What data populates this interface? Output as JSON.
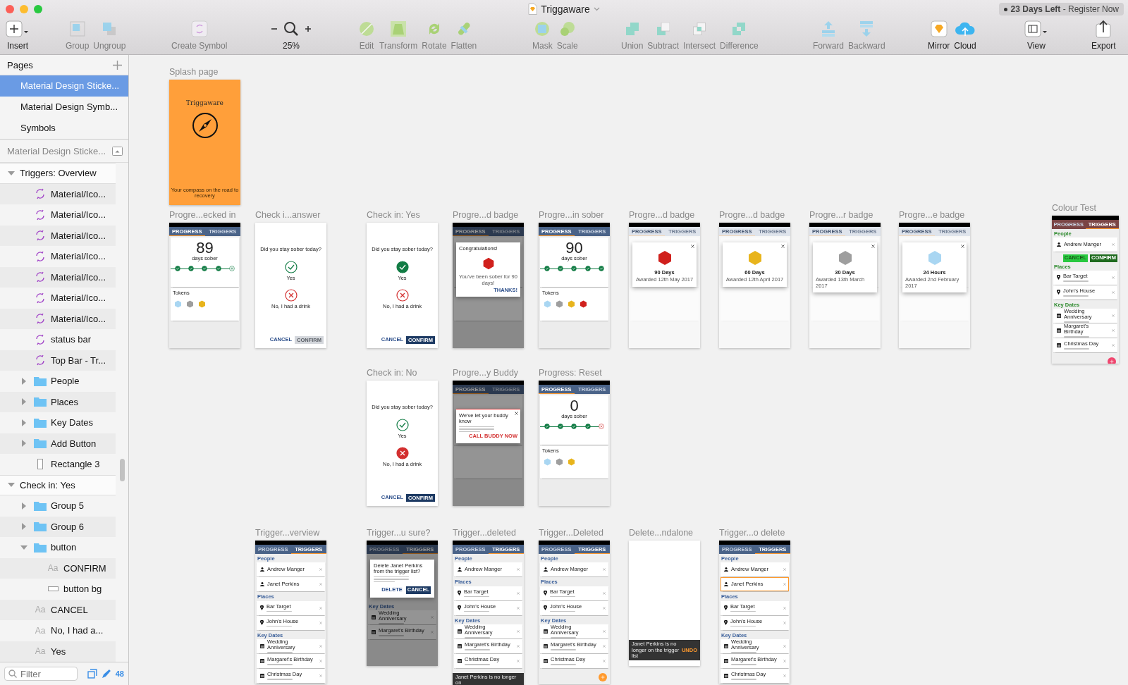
{
  "window": {
    "title": "Triggaware",
    "trial": "**23 Days Left** - Register Now"
  },
  "toolbar": {
    "groups": [
      {
        "tools": [
          {
            "label": "Insert",
            "kind": "insert",
            "disabled": false
          }
        ]
      },
      {
        "tools": [
          {
            "label": "Group",
            "kind": "group",
            "disabled": true
          },
          {
            "label": "Ungroup",
            "kind": "ungroup",
            "disabled": true
          }
        ]
      },
      {
        "tools": [
          {
            "label": "Create Symbol",
            "kind": "symbol",
            "disabled": true
          }
        ]
      },
      {
        "tools": [
          {
            "label": "25%",
            "kind": "zoom",
            "disabled": false
          }
        ]
      },
      {
        "tools": [
          {
            "label": "Edit",
            "kind": "edit",
            "disabled": true
          },
          {
            "label": "Transform",
            "kind": "transform",
            "disabled": true
          },
          {
            "label": "Rotate",
            "kind": "rotate",
            "disabled": true
          },
          {
            "label": "Flatten",
            "kind": "flatten",
            "disabled": true
          }
        ]
      },
      {
        "tools": [
          {
            "label": "Mask",
            "kind": "mask",
            "disabled": true
          },
          {
            "label": "Scale",
            "kind": "scale",
            "disabled": true
          }
        ]
      },
      {
        "tools": [
          {
            "label": "Union",
            "kind": "union",
            "disabled": true
          },
          {
            "label": "Subtract",
            "kind": "subtract",
            "disabled": true
          },
          {
            "label": "Intersect",
            "kind": "intersect",
            "disabled": true
          },
          {
            "label": "Difference",
            "kind": "difference",
            "disabled": true
          }
        ]
      },
      {
        "tools": [
          {
            "label": "Forward",
            "kind": "forward",
            "disabled": true
          },
          {
            "label": "Backward",
            "kind": "backward",
            "disabled": true
          }
        ]
      },
      {
        "tools": [
          {
            "label": "Mirror",
            "kind": "mirror",
            "disabled": false
          },
          {
            "label": "Cloud",
            "kind": "cloud",
            "disabled": false
          }
        ]
      },
      {
        "tools": [
          {
            "label": "View",
            "kind": "view",
            "disabled": false
          }
        ]
      },
      {
        "tools": [
          {
            "label": "Export",
            "kind": "export",
            "disabled": false
          }
        ]
      }
    ]
  },
  "sidebar": {
    "pages_title": "Pages",
    "pages": [
      {
        "label": "Material Design Sticke...",
        "selected": true
      },
      {
        "label": "Material Design Symb...",
        "selected": false
      },
      {
        "label": "Symbols",
        "selected": false
      }
    ],
    "page_header": "Material Design Sticke...",
    "layers": [
      {
        "label": "Triggers: Overview",
        "kind": "artboard",
        "expanded": true,
        "children": [
          {
            "label": "Material/Ico...",
            "kind": "symbol"
          },
          {
            "label": "Material/Ico...",
            "kind": "symbol"
          },
          {
            "label": "Material/Ico...",
            "kind": "symbol"
          },
          {
            "label": "Material/Ico...",
            "kind": "symbol"
          },
          {
            "label": "Material/Ico...",
            "kind": "symbol"
          },
          {
            "label": "Material/Ico...",
            "kind": "symbol"
          },
          {
            "label": "Material/Ico...",
            "kind": "symbol"
          },
          {
            "label": "status bar",
            "kind": "symbol"
          },
          {
            "label": "Top Bar - Tr...",
            "kind": "symbol"
          },
          {
            "label": "People",
            "kind": "folder",
            "expanded": false
          },
          {
            "label": "Places",
            "kind": "folder",
            "expanded": false
          },
          {
            "label": "Key Dates",
            "kind": "folder",
            "expanded": false
          },
          {
            "label": "Add Button",
            "kind": "folder",
            "expanded": false
          },
          {
            "label": "Rectangle 3",
            "kind": "rect"
          }
        ]
      },
      {
        "label": "Check in: Yes",
        "kind": "artboard",
        "expanded": true,
        "children": [
          {
            "label": "Group 5",
            "kind": "folder",
            "expanded": false
          },
          {
            "label": "Group 6",
            "kind": "folder",
            "expanded": false
          },
          {
            "label": "button",
            "kind": "folder",
            "expanded": true,
            "children": [
              {
                "label": "CONFIRM",
                "kind": "text",
                "glyph": "Aa"
              },
              {
                "label": "button bg",
                "kind": "bar"
              }
            ]
          },
          {
            "label": "CANCEL",
            "kind": "text",
            "glyph": "Aa"
          },
          {
            "label": "No, I had a...",
            "kind": "text",
            "glyph": "Aa"
          },
          {
            "label": "Yes",
            "kind": "text",
            "glyph": "Aa"
          }
        ]
      }
    ],
    "filter": {
      "placeholder": "Filter"
    },
    "count": "48"
  },
  "artboards": [
    {
      "label": "Splash page",
      "screen": {
        "kind": "splash",
        "title": "Triggaware",
        "tagline": "Your compass on the road to recovery"
      }
    },
    {
      "label": "Progre...ecked in",
      "screen": {
        "kind": "progress",
        "dimmed": false,
        "faded": false,
        "tabs": [
          {
            "label": "PROGRESS",
            "selected": true
          },
          {
            "label": "TRIGGERS",
            "selected": false
          }
        ],
        "count": "89",
        "caption": "days sober",
        "days": [
          {
            "done": true,
            "missed": false
          },
          {
            "done": true,
            "missed": false
          },
          {
            "done": true,
            "missed": false
          },
          {
            "done": true,
            "missed": false
          },
          {
            "done": false,
            "missed": false
          }
        ],
        "tokens_title": "Tokens",
        "tokens": [
          {
            "color": "#a9d6f2"
          },
          {
            "color": "#9e9e9e"
          },
          {
            "color": "#e8b41c"
          }
        ]
      }
    },
    {
      "label": "Check i...answer",
      "screen": {
        "kind": "checkin",
        "question": "Did you stay sober today?",
        "yes": "Yes",
        "no": "No, I had a drink",
        "cancel": "CANCEL",
        "confirm": "CONFIRM",
        "answered_yes": false,
        "answered_no": false
      }
    },
    {
      "label": "Check in: Yes",
      "screen": {
        "kind": "checkin",
        "question": "Did you stay sober today?",
        "yes": "Yes",
        "no": "No, I had a drink",
        "cancel": "CANCEL",
        "confirm": "CONFIRM",
        "answered_yes": true,
        "answered_no": false
      }
    },
    {
      "label": "Progre...d badge",
      "screen": {
        "kind": "progress",
        "dimmed": true,
        "faded": false,
        "tabs": [
          {
            "label": "PROGRESS",
            "selected": true
          },
          {
            "label": "TRIGGERS",
            "selected": false
          }
        ],
        "dialog": {
          "kind": "congrats",
          "color": "#d0201c",
          "title": "Congratulations!",
          "text": "You've been sober for 90 days!",
          "action": "THANKS!"
        }
      }
    },
    {
      "label": "Progre...in sober",
      "screen": {
        "kind": "progress",
        "dimmed": false,
        "faded": false,
        "tabs": [
          {
            "label": "PROGRESS",
            "selected": true
          },
          {
            "label": "TRIGGERS",
            "selected": false
          }
        ],
        "count": "90",
        "caption": "days sober",
        "days": [
          {
            "done": true,
            "missed": false
          },
          {
            "done": true,
            "missed": false
          },
          {
            "done": true,
            "missed": false
          },
          {
            "done": true,
            "missed": false
          },
          {
            "done": true,
            "missed": false
          }
        ],
        "tokens_title": "Tokens",
        "tokens": [
          {
            "color": "#a9d6f2"
          },
          {
            "color": "#9e9e9e"
          },
          {
            "color": "#e8b41c"
          },
          {
            "color": "#d0201c"
          }
        ]
      }
    },
    {
      "label": "Progre...d badge",
      "screen": {
        "kind": "progress",
        "dimmed": false,
        "faded": true,
        "tabs": [
          {
            "label": "PROGRESS",
            "selected": true
          },
          {
            "label": "TRIGGERS",
            "selected": false
          }
        ],
        "dialog": {
          "kind": "badge",
          "color": "#d0201c",
          "title": "90 Days",
          "text": "Awarded 12th May 2017"
        }
      }
    },
    {
      "label": "Progre...d badge",
      "screen": {
        "kind": "progress",
        "dimmed": false,
        "faded": true,
        "tabs": [
          {
            "label": "PROGRESS",
            "selected": true
          },
          {
            "label": "TRIGGERS",
            "selected": false
          }
        ],
        "dialog": {
          "kind": "badge",
          "color": "#e8b41c",
          "title": "60 Days",
          "text": "Awarded 12th April 2017"
        }
      }
    },
    {
      "label": "Progre...r badge",
      "screen": {
        "kind": "progress",
        "dimmed": false,
        "faded": true,
        "tabs": [
          {
            "label": "PROGRESS",
            "selected": true
          },
          {
            "label": "TRIGGERS",
            "selected": false
          }
        ],
        "dialog": {
          "kind": "badge",
          "color": "#9e9e9e",
          "title": "30 Days",
          "text": "Awarded 13th March 2017"
        }
      }
    },
    {
      "label": "Progre...e badge",
      "screen": {
        "kind": "progress",
        "dimmed": false,
        "faded": true,
        "tabs": [
          {
            "label": "PROGRESS",
            "selected": true
          },
          {
            "label": "TRIGGERS",
            "selected": false
          }
        ],
        "dialog": {
          "kind": "badge",
          "color": "#a9d6f2",
          "title": "24 Hours",
          "text": "Awarded 2nd February 2017"
        }
      }
    },
    {
      "label": "Colour Test",
      "screen": {
        "kind": "triggers",
        "alt_theme": true,
        "dimmed": false,
        "fab": true,
        "tabs": [
          {
            "label": "PROGRESS",
            "selected": false
          },
          {
            "label": "TRIGGERS",
            "selected": true
          }
        ],
        "sections": [
          {
            "kind": "people",
            "title": "People",
            "actions": [
              "CANCEL",
              "CONFIRM"
            ],
            "items": [
              {
                "name": "Andrew Manger",
                "selected": false
              }
            ]
          },
          {
            "kind": "places",
            "title": "Places",
            "items": [
              {
                "name": "Bar Target",
                "selected": false
              },
              {
                "name": "John's House",
                "selected": false
              }
            ]
          },
          {
            "kind": "dates",
            "title": "Key Dates",
            "items": [
              {
                "name": "Wedding Anniversary",
                "selected": false
              },
              {
                "name": "Margaret's Birthday",
                "selected": false
              },
              {
                "name": "Christmas Day",
                "selected": false
              }
            ]
          }
        ]
      }
    },
    {
      "label": "Check in: No",
      "screen": {
        "kind": "checkin",
        "question": "Did you stay sober today?",
        "yes": "Yes",
        "no": "No, I had a drink",
        "cancel": "CANCEL",
        "confirm": "CONFIRM",
        "answered_yes": false,
        "answered_no": true
      }
    },
    {
      "label": "Progre...y Buddy",
      "screen": {
        "kind": "progress",
        "dimmed": true,
        "faded": false,
        "tabs": [
          {
            "label": "PROGRESS",
            "selected": true
          },
          {
            "label": "TRIGGERS",
            "selected": false
          }
        ],
        "dialog": {
          "kind": "buddy",
          "color": "#d33333",
          "title": "We've let your buddy know",
          "action": "CALL BUDDY NOW"
        }
      }
    },
    {
      "label": "Progress: Reset",
      "screen": {
        "kind": "progress",
        "dimmed": false,
        "faded": false,
        "tabs": [
          {
            "label": "PROGRESS",
            "selected": true
          },
          {
            "label": "TRIGGERS",
            "selected": false
          }
        ],
        "count": "0",
        "caption": "days sober",
        "days": [
          {
            "done": true,
            "missed": false
          },
          {
            "done": true,
            "missed": false
          },
          {
            "done": true,
            "missed": false
          },
          {
            "done": true,
            "missed": false
          },
          {
            "done": false,
            "missed": true
          }
        ],
        "tokens_title": "Tokens",
        "tokens": [
          {
            "color": "#a9d6f2"
          },
          {
            "color": "#9e9e9e"
          },
          {
            "color": "#e8b41c"
          }
        ]
      }
    },
    {
      "label": "Trigger...verview",
      "screen": {
        "kind": "triggers",
        "alt_theme": false,
        "dimmed": false,
        "fab": false,
        "tabs": [
          {
            "label": "PROGRESS",
            "selected": false
          },
          {
            "label": "TRIGGERS",
            "selected": true
          }
        ],
        "sections": [
          {
            "kind": "people",
            "title": "People",
            "items": [
              {
                "name": "Andrew Manger",
                "selected": false
              },
              {
                "name": "Janet Perkins",
                "selected": false
              }
            ]
          },
          {
            "kind": "places",
            "title": "Places",
            "items": [
              {
                "name": "Bar Target",
                "selected": false
              },
              {
                "name": "John's House",
                "selected": false
              }
            ]
          },
          {
            "kind": "dates",
            "title": "Key Dates",
            "items": [
              {
                "name": "Wedding Anniversary",
                "selected": false
              },
              {
                "name": "Margaret's Birthday",
                "selected": false
              },
              {
                "name": "Christmas Day",
                "selected": false
              }
            ]
          }
        ]
      }
    },
    {
      "label": "Trigger...u sure?",
      "screen": {
        "kind": "triggers",
        "alt_theme": false,
        "dimmed": true,
        "fab": false,
        "tabs": [
          {
            "label": "PROGRESS",
            "selected": false
          },
          {
            "label": "TRIGGERS",
            "selected": true
          }
        ],
        "dialog": {
          "title": "Delete Janet Perkins from the trigger list?",
          "actions": [
            "DELETE",
            "CANCEL"
          ]
        },
        "sections": [
          {
            "kind": "dates",
            "title": "Key Dates",
            "items": [
              {
                "name": "Wedding Anniversary",
                "selected": false
              },
              {
                "name": "Margaret's Birthday",
                "selected": false
              }
            ]
          }
        ]
      }
    },
    {
      "label": "Trigger...deleted",
      "screen": {
        "kind": "triggers",
        "alt_theme": false,
        "dimmed": false,
        "fab": false,
        "tabs": [
          {
            "label": "PROGRESS",
            "selected": false
          },
          {
            "label": "TRIGGERS",
            "selected": true
          }
        ],
        "snackbar": {
          "text": "Janet Perkins is no longer on"
        },
        "sections": [
          {
            "kind": "people",
            "title": "People",
            "items": [
              {
                "name": "Andrew Manger",
                "selected": false
              }
            ]
          },
          {
            "kind": "places",
            "title": "Places",
            "items": [
              {
                "name": "Bar Target",
                "selected": false
              },
              {
                "name": "John's House",
                "selected": false
              }
            ]
          },
          {
            "kind": "dates",
            "title": "Key Dates",
            "items": [
              {
                "name": "Wedding Anniversary",
                "selected": false
              },
              {
                "name": "Margaret's Birthday",
                "selected": false
              },
              {
                "name": "Christmas Day",
                "selected": false
              }
            ]
          }
        ]
      }
    },
    {
      "label": "Trigger...Deleted",
      "screen": {
        "kind": "triggers",
        "alt_theme": false,
        "dimmed": false,
        "fab": true,
        "tabs": [
          {
            "label": "PROGRESS",
            "selected": false
          },
          {
            "label": "TRIGGERS",
            "selected": true
          }
        ],
        "sections": [
          {
            "kind": "people",
            "title": "People",
            "items": [
              {
                "name": "Andrew Manger",
                "selected": false
              }
            ]
          },
          {
            "kind": "places",
            "title": "Places",
            "items": [
              {
                "name": "Bar Target",
                "selected": false
              },
              {
                "name": "John's House",
                "selected": false
              }
            ]
          },
          {
            "kind": "dates",
            "title": "Key Dates",
            "items": [
              {
                "name": "Wedding Anniversary",
                "selected": false
              },
              {
                "name": "Margaret's Birthday",
                "selected": false
              },
              {
                "name": "Christmas Day",
                "selected": false
              }
            ]
          }
        ]
      }
    },
    {
      "label": "Delete...ndalone",
      "screen": {
        "kind": "blank",
        "snackbar": {
          "text": "Janet Perkins is no longer on the trigger list",
          "action": "UNDO"
        }
      }
    },
    {
      "label": "Trigger...o delete",
      "screen": {
        "kind": "triggers",
        "alt_theme": false,
        "dimmed": false,
        "fab": false,
        "tabs": [
          {
            "label": "PROGRESS",
            "selected": false
          },
          {
            "label": "TRIGGERS",
            "selected": true
          }
        ],
        "sections": [
          {
            "kind": "people",
            "title": "People",
            "items": [
              {
                "name": "Andrew Manger",
                "selected": false
              },
              {
                "name": "Janet Perkins",
                "selected": true
              }
            ]
          },
          {
            "kind": "places",
            "title": "Places",
            "items": [
              {
                "name": "Bar Target",
                "selected": false
              },
              {
                "name": "John's House",
                "selected": false
              }
            ]
          },
          {
            "kind": "dates",
            "title": "Key Dates",
            "items": [
              {
                "name": "Wedding Anniversary",
                "selected": false
              },
              {
                "name": "Margaret's Birthday",
                "selected": false
              },
              {
                "name": "Christmas Day",
                "selected": false
              }
            ]
          }
        ]
      }
    }
  ]
}
